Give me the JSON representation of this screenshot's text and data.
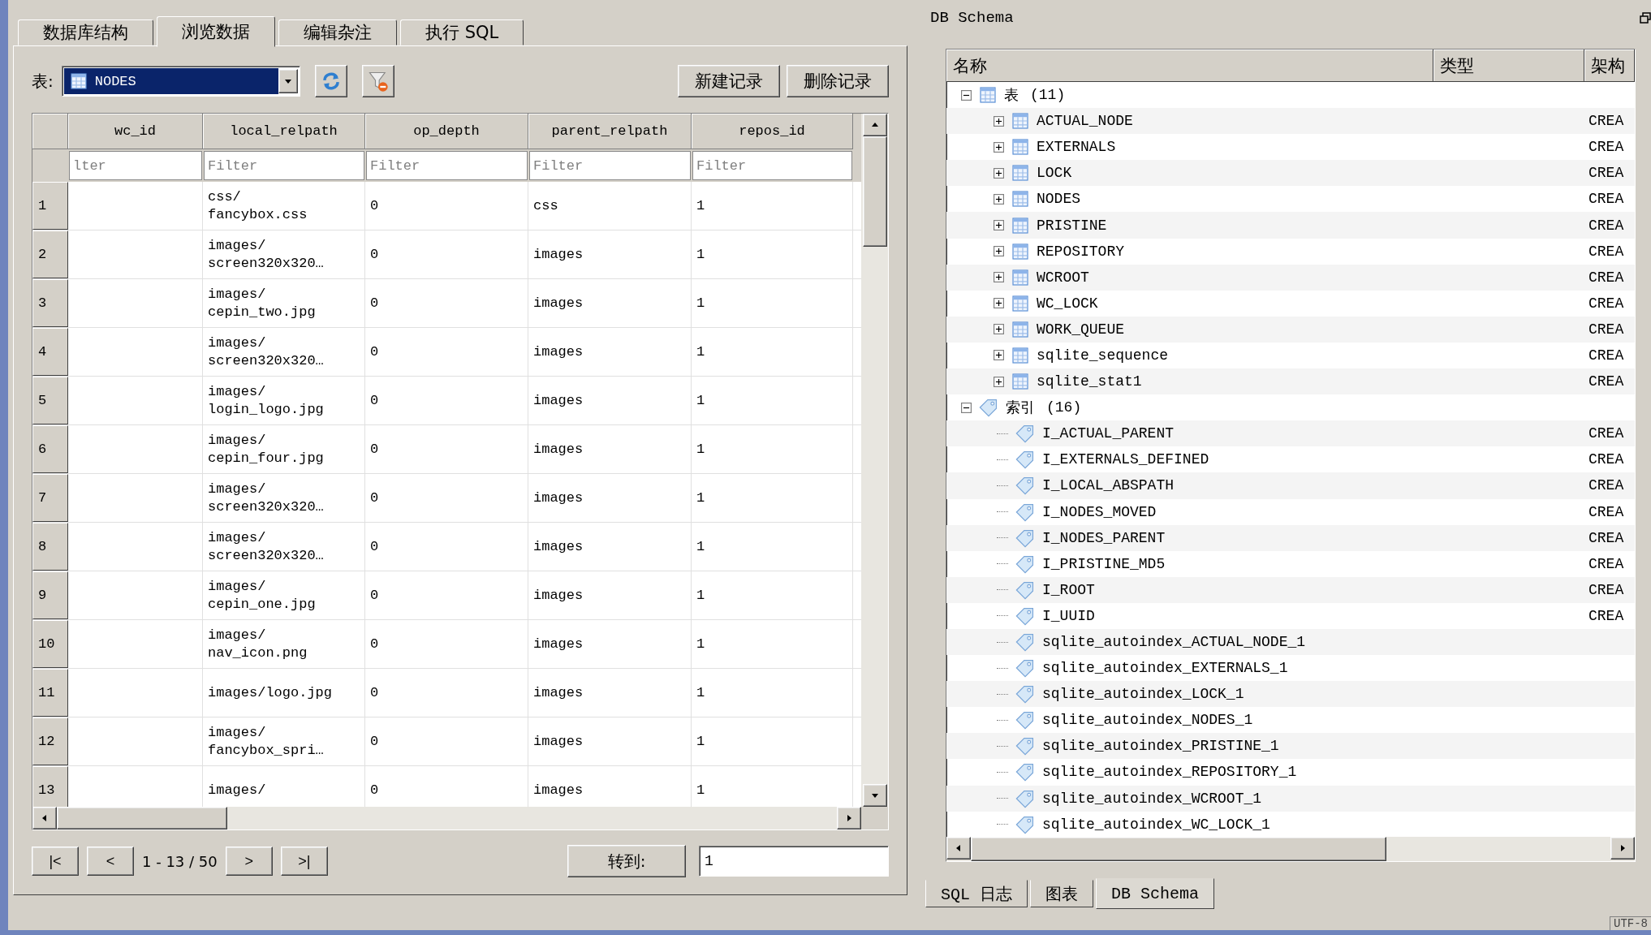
{
  "left_panel": {
    "tabs": [
      {
        "label": "数据库结构",
        "selected": false
      },
      {
        "label": "浏览数据",
        "selected": true
      },
      {
        "label": "编辑杂注",
        "selected": false
      },
      {
        "label": "执行 SQL",
        "selected": false
      }
    ],
    "table_label": "表:",
    "table_select": {
      "value": "NODES"
    },
    "buttons": [
      "新建记录",
      "删除记录"
    ],
    "grid": {
      "columns": [
        {
          "label": "wc_id",
          "placeholder": "lter"
        },
        {
          "label": "local_relpath",
          "placeholder": "Filter"
        },
        {
          "label": "op_depth",
          "placeholder": "Filter"
        },
        {
          "label": "parent_relpath",
          "placeholder": "Filter"
        },
        {
          "label": "repos_id",
          "placeholder": "Filter"
        }
      ],
      "rows": [
        {
          "number": "1",
          "cells": [
            "",
            "css/\nfancybox.css",
            "0",
            "css",
            "1"
          ]
        },
        {
          "number": "2",
          "cells": [
            "",
            "images/\nscreen320x320…",
            "0",
            "images",
            "1"
          ]
        },
        {
          "number": "3",
          "cells": [
            "",
            "images/\ncepin_two.jpg",
            "0",
            "images",
            "1"
          ]
        },
        {
          "number": "4",
          "cells": [
            "",
            "images/\nscreen320x320…",
            "0",
            "images",
            "1"
          ]
        },
        {
          "number": "5",
          "cells": [
            "",
            "images/\nlogin_logo.jpg",
            "0",
            "images",
            "1"
          ]
        },
        {
          "number": "6",
          "cells": [
            "",
            "images/\ncepin_four.jpg",
            "0",
            "images",
            "1"
          ]
        },
        {
          "number": "7",
          "cells": [
            "",
            "images/\nscreen320x320…",
            "0",
            "images",
            "1"
          ]
        },
        {
          "number": "8",
          "cells": [
            "",
            "images/\nscreen320x320…",
            "0",
            "images",
            "1"
          ]
        },
        {
          "number": "9",
          "cells": [
            "",
            "images/\ncepin_one.jpg",
            "0",
            "images",
            "1"
          ]
        },
        {
          "number": "10",
          "cells": [
            "",
            "images/\nnav_icon.png",
            "0",
            "images",
            "1"
          ]
        },
        {
          "number": "11",
          "cells": [
            "",
            "images/logo.jpg",
            "0",
            "images",
            "1"
          ]
        },
        {
          "number": "12",
          "cells": [
            "",
            "images/\nfancybox_spri…",
            "0",
            "images",
            "1"
          ]
        },
        {
          "number": "13",
          "cells": [
            "",
            "images/",
            "0",
            "images",
            "1"
          ]
        }
      ]
    },
    "pager": {
      "first": "|<",
      "prev": "<",
      "range": "1 - 13 / 50",
      "next": ">",
      "last": ">|",
      "goto_button": "转到:",
      "goto_value": "1"
    }
  },
  "schema_panel": {
    "title": "DB Schema",
    "columns": [
      "名称",
      "类型",
      "架构"
    ],
    "nodes": [
      {
        "kind": "tables",
        "label": "表",
        "count": "(11)",
        "expanded": true,
        "children": [
          {
            "label": "ACTUAL_NODE",
            "schema": "CREA",
            "expanded": false
          },
          {
            "label": "EXTERNALS",
            "schema": "CREA",
            "expanded": false
          },
          {
            "label": "LOCK",
            "schema": "CREA",
            "expanded": false
          },
          {
            "label": "NODES",
            "schema": "CREA",
            "expanded": false
          },
          {
            "label": "PRISTINE",
            "schema": "CREA",
            "expanded": false
          },
          {
            "label": "REPOSITORY",
            "schema": "CREA",
            "expanded": false
          },
          {
            "label": "WCROOT",
            "schema": "CREA",
            "expanded": false
          },
          {
            "label": "WC_LOCK",
            "schema": "CREA",
            "expanded": false
          },
          {
            "label": "WORK_QUEUE",
            "schema": "CREA",
            "expanded": false
          },
          {
            "label": "sqlite_sequence",
            "schema": "CREA",
            "expanded": false
          },
          {
            "label": "sqlite_stat1",
            "schema": "CREA",
            "expanded": false
          }
        ]
      },
      {
        "kind": "indexes",
        "label": "索引",
        "count": "(16)",
        "expanded": true,
        "children": [
          {
            "label": "I_ACTUAL_PARENT",
            "schema": "CREA"
          },
          {
            "label": "I_EXTERNALS_DEFINED",
            "schema": "CREA"
          },
          {
            "label": "I_LOCAL_ABSPATH",
            "schema": "CREA"
          },
          {
            "label": "I_NODES_MOVED",
            "schema": "CREA"
          },
          {
            "label": "I_NODES_PARENT",
            "schema": "CREA"
          },
          {
            "label": "I_PRISTINE_MD5",
            "schema": "CREA"
          },
          {
            "label": "I_ROOT",
            "schema": "CREA"
          },
          {
            "label": "I_UUID",
            "schema": "CREA"
          },
          {
            "label": "sqlite_autoindex_ACTUAL_NODE_1"
          },
          {
            "label": "sqlite_autoindex_EXTERNALS_1"
          },
          {
            "label": "sqlite_autoindex_LOCK_1"
          },
          {
            "label": "sqlite_autoindex_NODES_1"
          },
          {
            "label": "sqlite_autoindex_PRISTINE_1"
          },
          {
            "label": "sqlite_autoindex_REPOSITORY_1"
          },
          {
            "label": "sqlite_autoindex_WCROOT_1"
          },
          {
            "label": "sqlite_autoindex_WC_LOCK_1"
          }
        ]
      }
    ],
    "bottom_tabs": [
      {
        "label": "SQL 日志",
        "selected": false
      },
      {
        "label": "图表",
        "selected": false
      },
      {
        "label": "DB Schema",
        "selected": true
      }
    ]
  },
  "status_bar": {
    "encoding": "UTF-8"
  }
}
